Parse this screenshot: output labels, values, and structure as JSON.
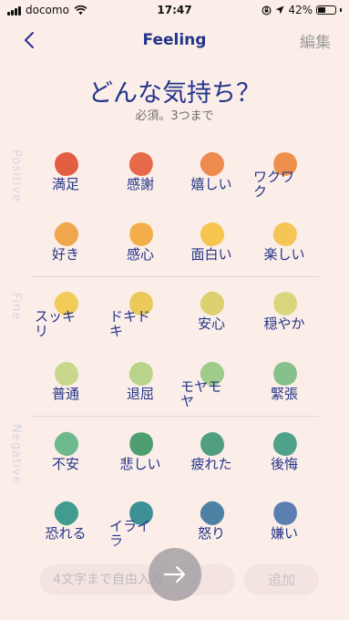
{
  "status": {
    "carrier": "docomo",
    "time": "17:47",
    "battery": "42%",
    "battery_level": 0.42
  },
  "nav": {
    "title": "Feeling",
    "edit_label": "編集"
  },
  "header": {
    "question": "どんな気持ち？",
    "subtitle": "必須。3つまで"
  },
  "sections": {
    "positive": "Positive",
    "fine": "Fine",
    "negative": "Negative"
  },
  "feelings": [
    {
      "label": "満足",
      "color": "#e25d42"
    },
    {
      "label": "感謝",
      "color": "#e6694a"
    },
    {
      "label": "嬉しい",
      "color": "#ee8a4e"
    },
    {
      "label": "ワクワク",
      "color": "#ee8f4c"
    },
    {
      "label": "好き",
      "color": "#f1a54c"
    },
    {
      "label": "感心",
      "color": "#f3ae4a"
    },
    {
      "label": "面白い",
      "color": "#f5c54f"
    },
    {
      "label": "楽しい",
      "color": "#f5c655"
    },
    {
      "label": "スッキリ",
      "color": "#f1cc58"
    },
    {
      "label": "ドキドキ",
      "color": "#eac958"
    },
    {
      "label": "安心",
      "color": "#ddd070"
    },
    {
      "label": "穏やか",
      "color": "#d8d57c"
    },
    {
      "label": "普通",
      "color": "#c8d78c"
    },
    {
      "label": "退屈",
      "color": "#b9d48a"
    },
    {
      "label": "モヤモヤ",
      "color": "#9fcc8a"
    },
    {
      "label": "緊張",
      "color": "#86c08a"
    },
    {
      "label": "不安",
      "color": "#6db88c"
    },
    {
      "label": "悲しい",
      "color": "#4e9e72"
    },
    {
      "label": "疲れた",
      "color": "#4f9f80"
    },
    {
      "label": "後悔",
      "color": "#50a18a"
    },
    {
      "label": "恐れる",
      "color": "#3f9c8e"
    },
    {
      "label": "イライラ",
      "color": "#3f8f97"
    },
    {
      "label": "怒り",
      "color": "#4e82a5"
    },
    {
      "label": "嫌い",
      "color": "#5a7fb0"
    }
  ],
  "input": {
    "placeholder": "4文字まで自由入力"
  },
  "add_label": "追加"
}
